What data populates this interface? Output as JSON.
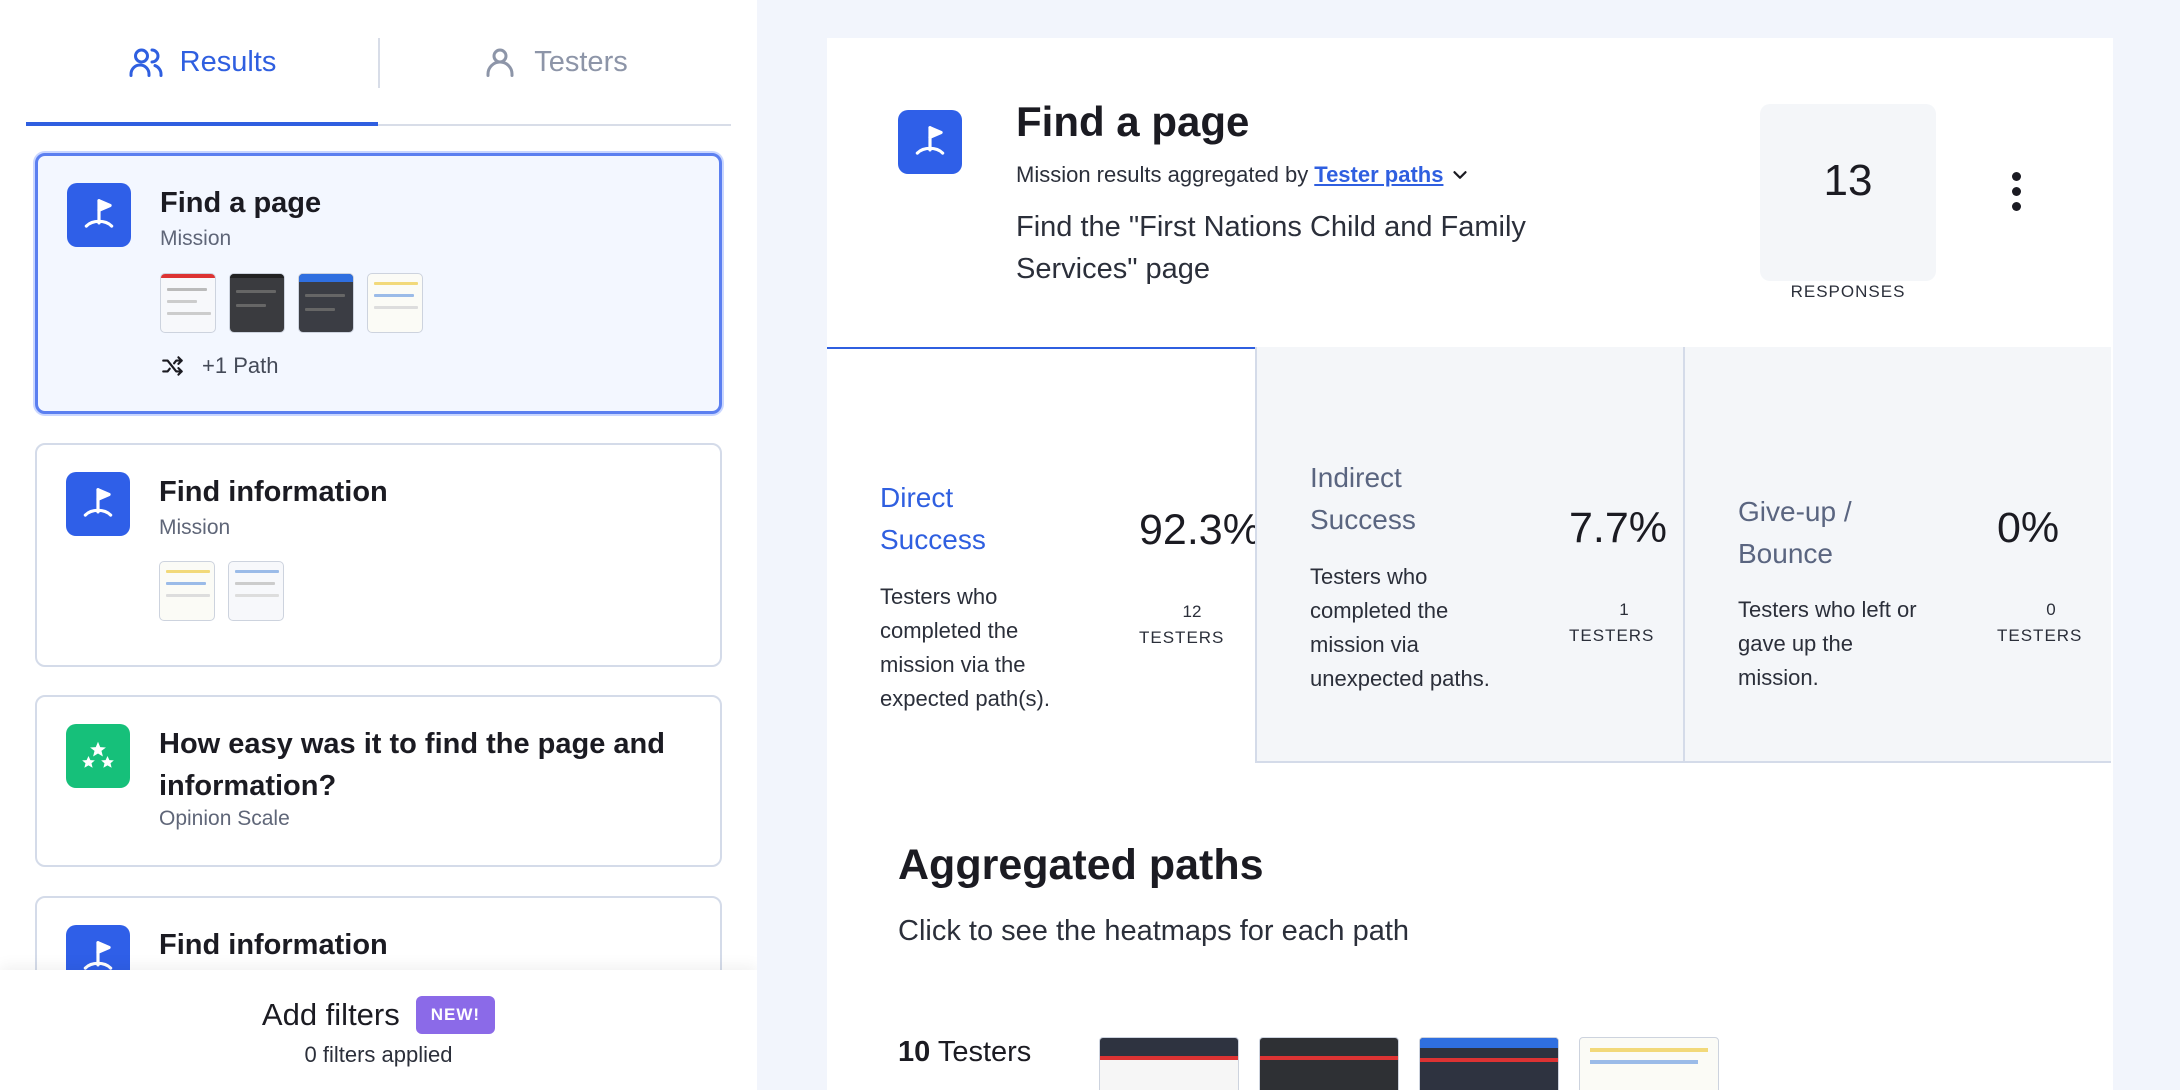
{
  "tabs": {
    "results": "Results",
    "testers": "Testers"
  },
  "cards": [
    {
      "title": "Find a page",
      "subtitle": "Mission",
      "path_label": "+1 Path",
      "icon": "flag-icon"
    },
    {
      "title": "Find information",
      "subtitle": "Mission",
      "icon": "flag-icon"
    },
    {
      "title": "How easy was it to find the page and information?",
      "subtitle": "Opinion Scale",
      "icon": "stars-icon"
    },
    {
      "title": "Find information",
      "icon": "flag-icon"
    }
  ],
  "filters": {
    "label": "Add filters",
    "badge": "NEW!",
    "count": "0 filters applied"
  },
  "mission": {
    "title": "Find a page",
    "aggregated_prefix": "Mission results aggregated by",
    "aggregated_link": "Tester paths",
    "description": "Find the \"First Nations Child and Family Services\" page",
    "responses_count": "13",
    "responses_label": "RESPONSES"
  },
  "stats": [
    {
      "title": "Direct Success",
      "desc": "Testers who completed the mission via the expected path(s).",
      "pct": "92.3%",
      "n": "12",
      "unit": "TESTERS",
      "color": "#2f5fe0"
    },
    {
      "title": "Indirect Success",
      "desc": "Testers who completed the mission via unexpected paths.",
      "pct": "7.7%",
      "n": "1",
      "unit": "TESTERS",
      "color": "#5a6580"
    },
    {
      "title": "Give-up / Bounce",
      "desc": "Testers who left or gave up the mission.",
      "pct": "0%",
      "n": "0",
      "unit": "TESTERS",
      "color": "#5a6580"
    }
  ],
  "aggregated": {
    "title": "Aggregated paths",
    "subtitle": "Click to see the heatmaps for each path",
    "testers_count": "10",
    "testers_label": "Testers"
  },
  "colors": {
    "accent": "#2f5fe0",
    "green": "#16c07a",
    "badge": "#8b6ae8"
  }
}
